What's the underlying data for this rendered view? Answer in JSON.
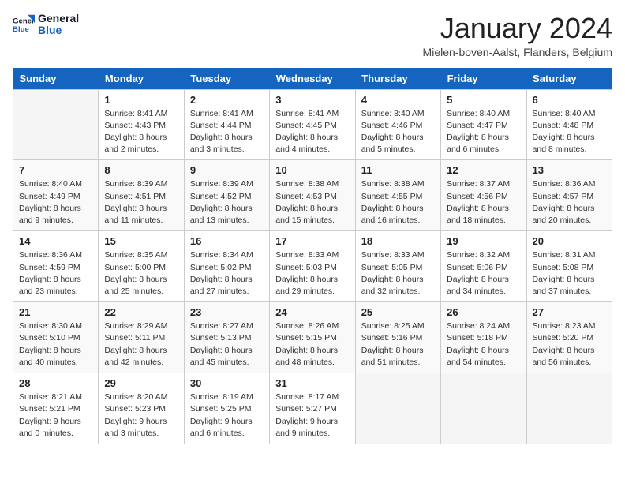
{
  "header": {
    "logo_line1": "General",
    "logo_line2": "Blue",
    "month_title": "January 2024",
    "location": "Mielen-boven-Aalst, Flanders, Belgium"
  },
  "weekdays": [
    "Sunday",
    "Monday",
    "Tuesday",
    "Wednesday",
    "Thursday",
    "Friday",
    "Saturday"
  ],
  "weeks": [
    [
      {
        "day": "",
        "sunrise": "",
        "sunset": "",
        "daylight": ""
      },
      {
        "day": "1",
        "sunrise": "Sunrise: 8:41 AM",
        "sunset": "Sunset: 4:43 PM",
        "daylight": "Daylight: 8 hours and 2 minutes."
      },
      {
        "day": "2",
        "sunrise": "Sunrise: 8:41 AM",
        "sunset": "Sunset: 4:44 PM",
        "daylight": "Daylight: 8 hours and 3 minutes."
      },
      {
        "day": "3",
        "sunrise": "Sunrise: 8:41 AM",
        "sunset": "Sunset: 4:45 PM",
        "daylight": "Daylight: 8 hours and 4 minutes."
      },
      {
        "day": "4",
        "sunrise": "Sunrise: 8:40 AM",
        "sunset": "Sunset: 4:46 PM",
        "daylight": "Daylight: 8 hours and 5 minutes."
      },
      {
        "day": "5",
        "sunrise": "Sunrise: 8:40 AM",
        "sunset": "Sunset: 4:47 PM",
        "daylight": "Daylight: 8 hours and 6 minutes."
      },
      {
        "day": "6",
        "sunrise": "Sunrise: 8:40 AM",
        "sunset": "Sunset: 4:48 PM",
        "daylight": "Daylight: 8 hours and 8 minutes."
      }
    ],
    [
      {
        "day": "7",
        "sunrise": "Sunrise: 8:40 AM",
        "sunset": "Sunset: 4:49 PM",
        "daylight": "Daylight: 8 hours and 9 minutes."
      },
      {
        "day": "8",
        "sunrise": "Sunrise: 8:39 AM",
        "sunset": "Sunset: 4:51 PM",
        "daylight": "Daylight: 8 hours and 11 minutes."
      },
      {
        "day": "9",
        "sunrise": "Sunrise: 8:39 AM",
        "sunset": "Sunset: 4:52 PM",
        "daylight": "Daylight: 8 hours and 13 minutes."
      },
      {
        "day": "10",
        "sunrise": "Sunrise: 8:38 AM",
        "sunset": "Sunset: 4:53 PM",
        "daylight": "Daylight: 8 hours and 15 minutes."
      },
      {
        "day": "11",
        "sunrise": "Sunrise: 8:38 AM",
        "sunset": "Sunset: 4:55 PM",
        "daylight": "Daylight: 8 hours and 16 minutes."
      },
      {
        "day": "12",
        "sunrise": "Sunrise: 8:37 AM",
        "sunset": "Sunset: 4:56 PM",
        "daylight": "Daylight: 8 hours and 18 minutes."
      },
      {
        "day": "13",
        "sunrise": "Sunrise: 8:36 AM",
        "sunset": "Sunset: 4:57 PM",
        "daylight": "Daylight: 8 hours and 20 minutes."
      }
    ],
    [
      {
        "day": "14",
        "sunrise": "Sunrise: 8:36 AM",
        "sunset": "Sunset: 4:59 PM",
        "daylight": "Daylight: 8 hours and 23 minutes."
      },
      {
        "day": "15",
        "sunrise": "Sunrise: 8:35 AM",
        "sunset": "Sunset: 5:00 PM",
        "daylight": "Daylight: 8 hours and 25 minutes."
      },
      {
        "day": "16",
        "sunrise": "Sunrise: 8:34 AM",
        "sunset": "Sunset: 5:02 PM",
        "daylight": "Daylight: 8 hours and 27 minutes."
      },
      {
        "day": "17",
        "sunrise": "Sunrise: 8:33 AM",
        "sunset": "Sunset: 5:03 PM",
        "daylight": "Daylight: 8 hours and 29 minutes."
      },
      {
        "day": "18",
        "sunrise": "Sunrise: 8:33 AM",
        "sunset": "Sunset: 5:05 PM",
        "daylight": "Daylight: 8 hours and 32 minutes."
      },
      {
        "day": "19",
        "sunrise": "Sunrise: 8:32 AM",
        "sunset": "Sunset: 5:06 PM",
        "daylight": "Daylight: 8 hours and 34 minutes."
      },
      {
        "day": "20",
        "sunrise": "Sunrise: 8:31 AM",
        "sunset": "Sunset: 5:08 PM",
        "daylight": "Daylight: 8 hours and 37 minutes."
      }
    ],
    [
      {
        "day": "21",
        "sunrise": "Sunrise: 8:30 AM",
        "sunset": "Sunset: 5:10 PM",
        "daylight": "Daylight: 8 hours and 40 minutes."
      },
      {
        "day": "22",
        "sunrise": "Sunrise: 8:29 AM",
        "sunset": "Sunset: 5:11 PM",
        "daylight": "Daylight: 8 hours and 42 minutes."
      },
      {
        "day": "23",
        "sunrise": "Sunrise: 8:27 AM",
        "sunset": "Sunset: 5:13 PM",
        "daylight": "Daylight: 8 hours and 45 minutes."
      },
      {
        "day": "24",
        "sunrise": "Sunrise: 8:26 AM",
        "sunset": "Sunset: 5:15 PM",
        "daylight": "Daylight: 8 hours and 48 minutes."
      },
      {
        "day": "25",
        "sunrise": "Sunrise: 8:25 AM",
        "sunset": "Sunset: 5:16 PM",
        "daylight": "Daylight: 8 hours and 51 minutes."
      },
      {
        "day": "26",
        "sunrise": "Sunrise: 8:24 AM",
        "sunset": "Sunset: 5:18 PM",
        "daylight": "Daylight: 8 hours and 54 minutes."
      },
      {
        "day": "27",
        "sunrise": "Sunrise: 8:23 AM",
        "sunset": "Sunset: 5:20 PM",
        "daylight": "Daylight: 8 hours and 56 minutes."
      }
    ],
    [
      {
        "day": "28",
        "sunrise": "Sunrise: 8:21 AM",
        "sunset": "Sunset: 5:21 PM",
        "daylight": "Daylight: 9 hours and 0 minutes."
      },
      {
        "day": "29",
        "sunrise": "Sunrise: 8:20 AM",
        "sunset": "Sunset: 5:23 PM",
        "daylight": "Daylight: 9 hours and 3 minutes."
      },
      {
        "day": "30",
        "sunrise": "Sunrise: 8:19 AM",
        "sunset": "Sunset: 5:25 PM",
        "daylight": "Daylight: 9 hours and 6 minutes."
      },
      {
        "day": "31",
        "sunrise": "Sunrise: 8:17 AM",
        "sunset": "Sunset: 5:27 PM",
        "daylight": "Daylight: 9 hours and 9 minutes."
      },
      {
        "day": "",
        "sunrise": "",
        "sunset": "",
        "daylight": ""
      },
      {
        "day": "",
        "sunrise": "",
        "sunset": "",
        "daylight": ""
      },
      {
        "day": "",
        "sunrise": "",
        "sunset": "",
        "daylight": ""
      }
    ]
  ]
}
